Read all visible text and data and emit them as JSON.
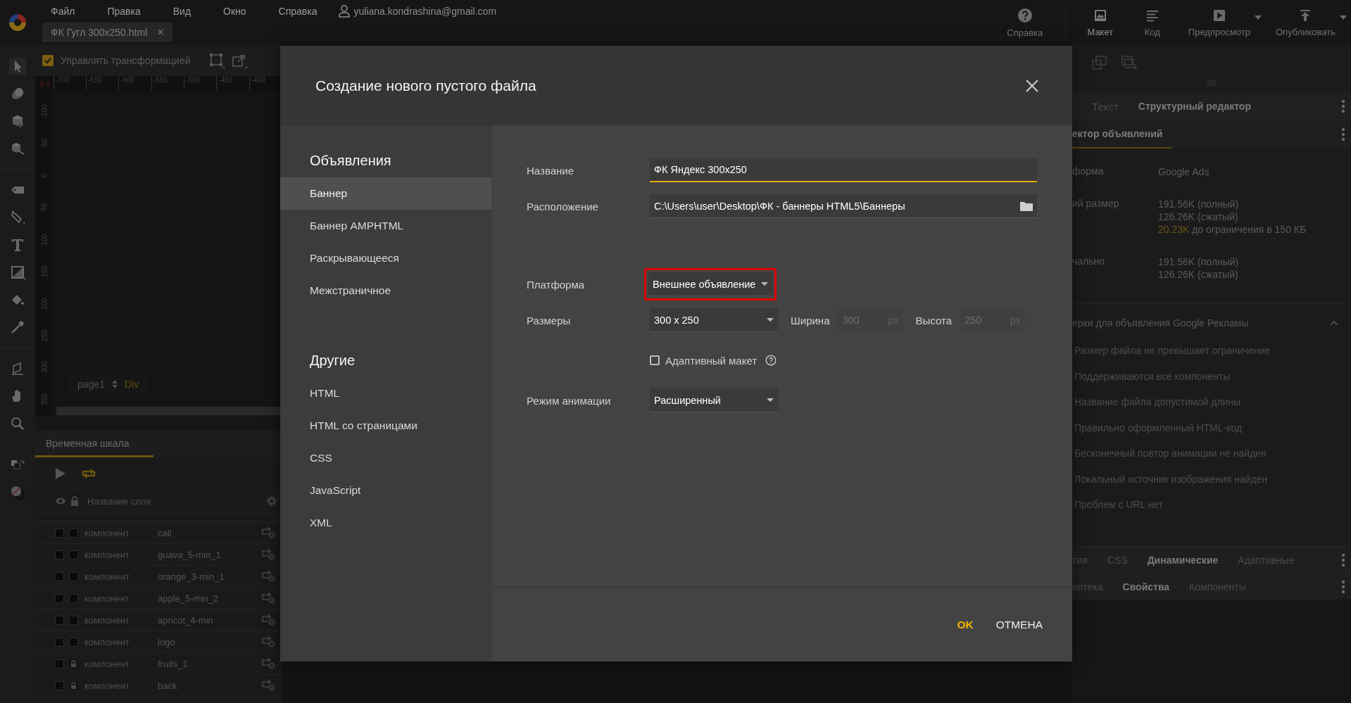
{
  "menu": [
    "Файл",
    "Правка",
    "Вид",
    "Окно",
    "Справка"
  ],
  "user": "yuliana.kondrashina@gmail.com",
  "document_tab": {
    "label": "ФК Гугл 300x250.html",
    "close": "×"
  },
  "help_button": {
    "label": "Справка"
  },
  "view_buttons": [
    {
      "kind": "design",
      "label": "Макет",
      "selected": true,
      "dropdown": false
    },
    {
      "kind": "code",
      "label": "Код",
      "selected": false,
      "dropdown": false
    },
    {
      "kind": "preview",
      "label": "Предпросмотр",
      "selected": false,
      "dropdown": true
    },
    {
      "kind": "publish",
      "label": "Опубликовать",
      "selected": false,
      "dropdown": true
    }
  ],
  "transform_toolbar": {
    "label": "Управлять трансформацией",
    "checked": true
  },
  "ruler": {
    "corner": "X Y",
    "x_ticks": [
      "-700",
      "-650",
      "-600",
      "-550",
      "-500",
      "-450",
      "-400"
    ],
    "y_ticks": [
      "-100",
      "-50",
      "0",
      "50",
      "100",
      "150",
      "200",
      "250",
      "300",
      "350"
    ]
  },
  "breadcrumb": {
    "page": "page1",
    "element": "Div"
  },
  "timeline": {
    "tab": "Временная шкала",
    "column_header": "Название слоя",
    "layers": [
      {
        "type": "компонент",
        "name": "call",
        "locked": false
      },
      {
        "type": "компонент",
        "name": "guava_5-min_1",
        "locked": false
      },
      {
        "type": "компонент",
        "name": "orange_3-min_1",
        "locked": false
      },
      {
        "type": "компонент",
        "name": "apple_5-min_2",
        "locked": false
      },
      {
        "type": "компонент",
        "name": "apricot_4-min",
        "locked": false
      },
      {
        "type": "компонент",
        "name": "logo",
        "locked": false
      },
      {
        "type": "компонент",
        "name": "fruits_1",
        "locked": true
      },
      {
        "type": "компонент",
        "name": "back",
        "locked": true
      }
    ]
  },
  "right_panel": {
    "tabs": [
      {
        "label": "Текст",
        "selected": false
      },
      {
        "label": "Структурный редактор",
        "selected": true
      }
    ],
    "section_tab": "ектор объявлений",
    "properties": [
      {
        "label": "форма",
        "values": [
          "Google Ads"
        ]
      },
      {
        "label": "ий размер",
        "values": [
          "191.56K (полный)",
          "126.26K (сжатый)",
          {
            "accent": "20.23K",
            "rest": "до ограничения в 150 КБ"
          }
        ]
      },
      {
        "label": "чально",
        "values": [
          "191.56K (полный)",
          "126.26K (сжатый)"
        ]
      }
    ],
    "checks": {
      "title": "ерки для объявления Google Рекламы",
      "expanded": true,
      "items": [
        "Размер файла не превышает ограничение",
        "Поддерживаются все компоненты",
        "Название файла допустимой длины",
        "Правильно оформленный HTML-код",
        "Бесконечный повтор анимации не найден",
        "Локальный источник изображения найден",
        "Проблем с URL нет"
      ]
    },
    "bottom_tabs": [
      [
        {
          "label": "тия",
          "selected": false
        },
        {
          "label": "CSS",
          "selected": false
        },
        {
          "label": "Динамические",
          "selected": true
        },
        {
          "label": "Адаптивные",
          "selected": false
        }
      ],
      [
        {
          "label": "иотека",
          "selected": false
        },
        {
          "label": "Свойства",
          "selected": true
        },
        {
          "label": "Компоненты",
          "selected": false
        }
      ]
    ]
  },
  "dialog": {
    "title": "Создание нового пустого файла",
    "nav": [
      {
        "heading": "Объявления",
        "items": [
          {
            "label": "Баннер",
            "selected": true
          },
          {
            "label": "Баннер AMPHTML",
            "selected": false
          },
          {
            "label": "Раскрывающееся",
            "selected": false
          },
          {
            "label": "Межстраничное",
            "selected": false
          }
        ]
      },
      {
        "heading": "Другие",
        "items": [
          {
            "label": "HTML",
            "selected": false
          },
          {
            "label": "HTML со страницами",
            "selected": false
          },
          {
            "label": "CSS",
            "selected": false
          },
          {
            "label": "JavaScript",
            "selected": false
          },
          {
            "label": "XML",
            "selected": false
          }
        ]
      }
    ],
    "name": {
      "label": "Название",
      "value": "ФК Яндекс 300x250"
    },
    "location": {
      "label": "Расположение",
      "value": "C:\\Users\\user\\Desktop\\ФК - баннеры HTML5\\Баннеры"
    },
    "platform": {
      "label": "Платформа",
      "value": "Внешнее объявление",
      "highlighted": true
    },
    "size": {
      "label": "Размеры",
      "value": "300 x 250",
      "width_label": "Ширина",
      "width_value": "300",
      "width_unit": "px",
      "height_label": "Высота",
      "height_value": "250",
      "height_unit": "px"
    },
    "responsive": {
      "label": "Адаптивный макет",
      "checked": false
    },
    "animation": {
      "label": "Режим анимации",
      "value": "Расширенный"
    },
    "buttons": [
      {
        "label": "OK",
        "kind": "primary"
      },
      {
        "label": "ОТМЕНА",
        "kind": "secondary"
      }
    ]
  }
}
